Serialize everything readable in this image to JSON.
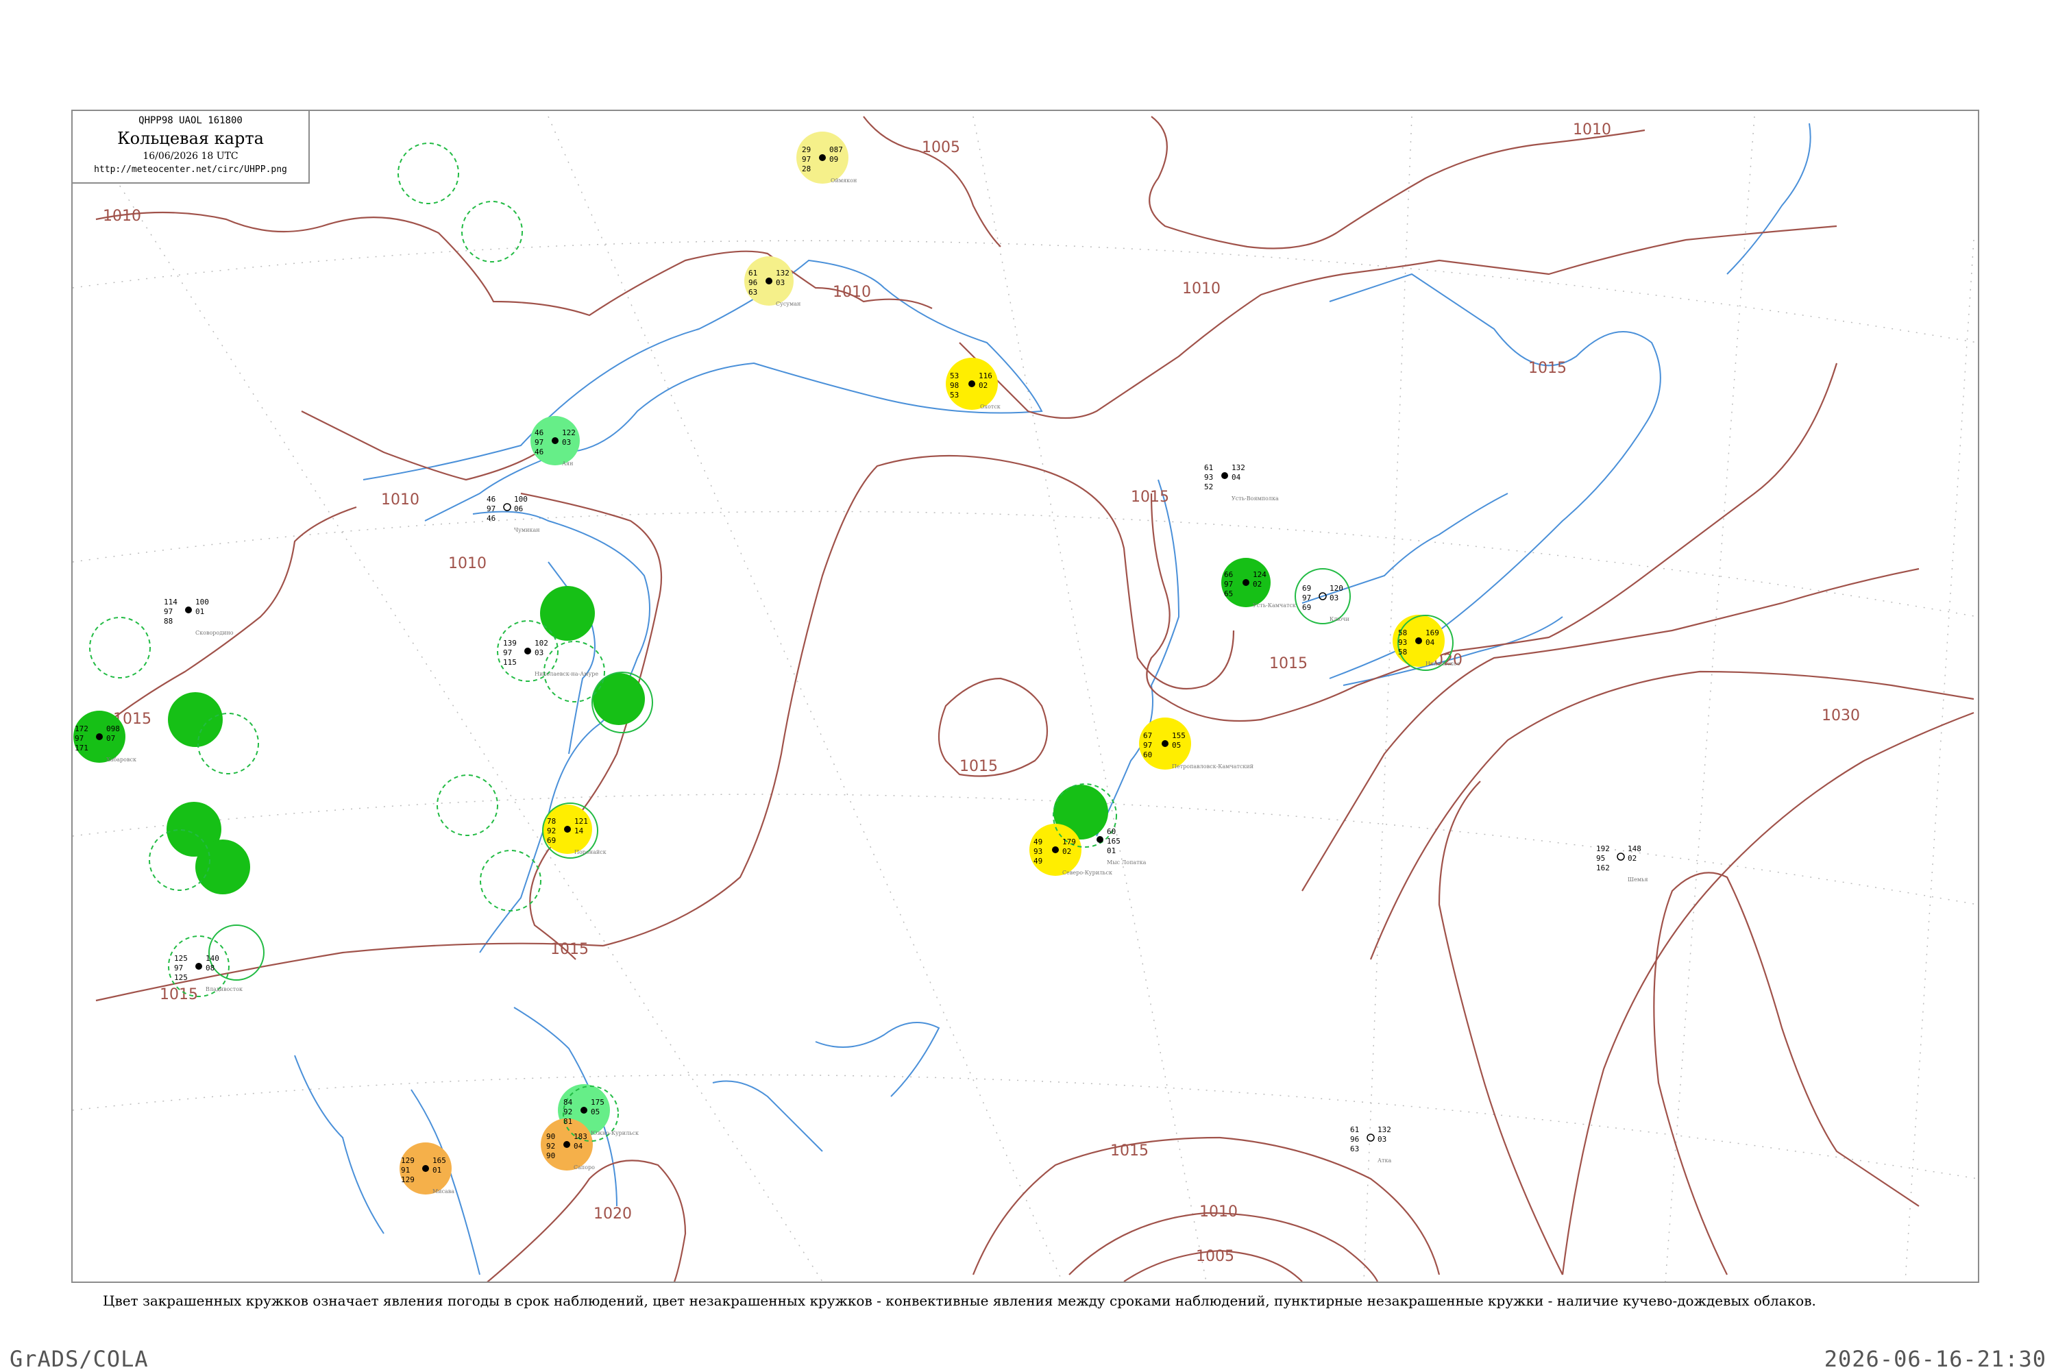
{
  "title_box": {
    "code": "QHPP98  UAOL  161800",
    "title": "Кольцевая карта",
    "date": "16/06/2026 18 UTC",
    "url": "http://meteocenter.net/circ/UHPP.png"
  },
  "legend_note": "Цвет закрашенных кружков означает явления погоды в срок наблюдений, цвет незакрашенных кружков - конвективные явления между сроками наблюдений, пунктирные незакрашенные кружки - наличие кучево-дождевых облаков.",
  "footer": {
    "left": "GrADS/COLA",
    "right": "2026-06-16-21:30"
  },
  "colors": {
    "isobar": "#a0524a",
    "river": "#4a90d9",
    "rain_green": "#16c016",
    "light_green": "#66ee88",
    "yellow": "#ffee00",
    "pale_yellow": "#f5f08a",
    "orange": "#f5b04a"
  },
  "isobar_labels": [
    "1005",
    "1010",
    "1010",
    "1010",
    "1010",
    "1010",
    "1010",
    "1015",
    "1015",
    "1015",
    "1015",
    "1015",
    "1015",
    "1015",
    "1020",
    "1020",
    "1030",
    "1015",
    "1010",
    "1005"
  ],
  "stations": [
    {
      "name": "Оймякон",
      "id": "24688",
      "t": "29",
      "p": "087",
      "d": "09",
      "v": "97",
      "lo": "28"
    },
    {
      "name": "Охотск",
      "id": "31088",
      "t": "53",
      "p": "116",
      "d": "02",
      "v": "98",
      "lo": "53"
    },
    {
      "name": "Аян",
      "id": "31168",
      "t": "46",
      "p": "122",
      "d": "03",
      "v": "97",
      "lo": "46"
    },
    {
      "name": "Усть-Камчатск",
      "id": "32389",
      "t": "66",
      "p": "124",
      "d": "02",
      "v": "97",
      "lo": "65"
    },
    {
      "name": "Ключи",
      "id": "32411",
      "t": "69",
      "p": "120",
      "d": "03",
      "v": "97",
      "lo": "69"
    },
    {
      "name": "Никольское",
      "id": "32618",
      "t": "58",
      "p": "169",
      "d": "04",
      "v": "93",
      "lo": "58"
    },
    {
      "name": "Петропавловск-Камчатский",
      "id": "32540",
      "t": "67",
      "p": "155",
      "d": "05",
      "v": "97",
      "lo": "60"
    },
    {
      "name": "Северо-Курильск",
      "id": "32215",
      "t": "49",
      "p": "179",
      "d": "02",
      "v": "93",
      "lo": "49"
    },
    {
      "name": "Южно-Курильск",
      "id": "32165",
      "t": "84",
      "p": "175",
      "d": "05",
      "v": "92",
      "lo": "81"
    },
    {
      "name": "Хабаровск",
      "id": "31735",
      "t": "172",
      "p": "098",
      "d": "07",
      "v": "97",
      "lo": "171"
    },
    {
      "name": "Николаевск-на-Амуре",
      "id": "31369",
      "t": "139",
      "p": "102",
      "d": "03",
      "v": "97",
      "lo": "115"
    },
    {
      "name": "Поронайск",
      "id": "32098",
      "t": "78",
      "p": "121",
      "d": "14",
      "v": "92",
      "lo": "69"
    },
    {
      "name": "Сусуман",
      "id": "24583",
      "t": "61",
      "p": "132",
      "d": "03",
      "v": "96",
      "lo": "63"
    },
    {
      "name": "Усть-Воямполка",
      "id": "32252",
      "t": "61",
      "p": "132",
      "d": "04",
      "v": "93",
      "lo": "52"
    },
    {
      "name": "Сапоро",
      "id": "47412",
      "t": "90",
      "p": "183",
      "d": "04",
      "v": "92",
      "lo": "90"
    },
    {
      "name": "Мисава",
      "id": "47575",
      "t": "129",
      "p": "165",
      "d": "01",
      "v": "91",
      "lo": "129"
    },
    {
      "name": "Владивосток",
      "id": "31960",
      "t": "125",
      "p": "140",
      "d": "08",
      "v": "97",
      "lo": "125"
    },
    {
      "name": "Сковородино",
      "id": "30673",
      "t": "114",
      "p": "100",
      "d": "01",
      "v": "97",
      "lo": "88"
    },
    {
      "name": "Чумикан",
      "id": "31263",
      "t": "46",
      "p": "100",
      "d": "06",
      "v": "97",
      "lo": "46"
    },
    {
      "name": "Атка",
      "id": "24466",
      "t": "61",
      "p": "132",
      "d": "03",
      "v": "96",
      "lo": "63"
    },
    {
      "name": "Мыс Лопатка",
      "id": "32217",
      "t": "60",
      "p": "165",
      "d": "01",
      "v": "97",
      "lo": "60"
    },
    {
      "name": "Шемья",
      "id": "70414",
      "t": "192",
      "p": "148",
      "d": "02",
      "v": "95",
      "lo": "162"
    }
  ]
}
